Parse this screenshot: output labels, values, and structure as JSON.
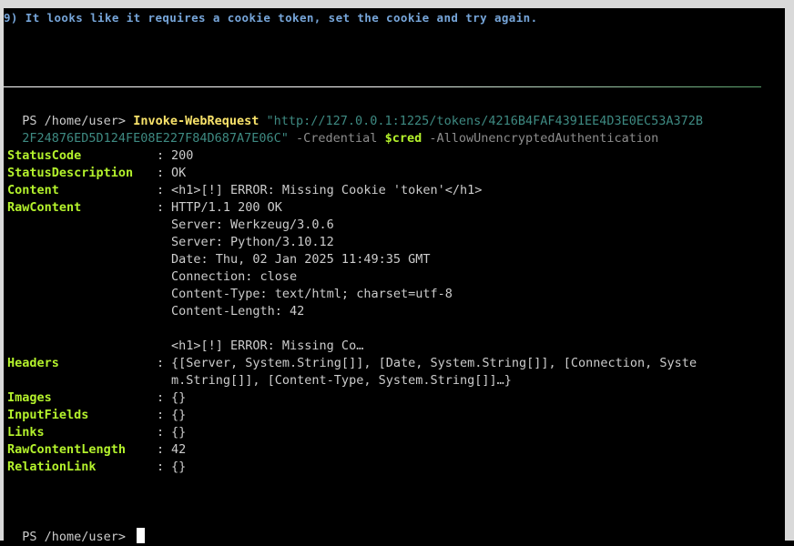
{
  "banner": "9) It looks like it requires a cookie token, set the cookie and try again.",
  "command": {
    "prompt": "PS /home/user> ",
    "cmdlet": "Invoke-WebRequest",
    "url_line1": "\"http://127.0.0.1:1225/tokens/4216B4FAF4391EE4D3E0EC53A372B",
    "url_line2": "2F24876ED5D124FE08E227F84D687A7E06C\"",
    "param1": "-Credential",
    "variable": "$cred",
    "param2": "-AllowUnencryptedAuthentication"
  },
  "output": {
    "separator": ":",
    "status_code": {
      "key": "StatusCode",
      "value": "200"
    },
    "status_description": {
      "key": "StatusDescription",
      "value": "OK"
    },
    "content": {
      "key": "Content",
      "value": "<h1>[!] ERROR: Missing Cookie 'token'</h1>"
    },
    "raw_content": {
      "key": "RawContent",
      "lines": [
        "HTTP/1.1 200 OK",
        "Server: Werkzeug/3.0.6",
        "Server: Python/3.10.12",
        "Date: Thu, 02 Jan 2025 11:49:35 GMT",
        "Connection: close",
        "Content-Type: text/html; charset=utf-8",
        "Content-Length: 42",
        "",
        "<h1>[!] ERROR: Missing Co…"
      ]
    },
    "headers": {
      "key": "Headers",
      "line1": "{[Server, System.String[]], [Date, System.String[]], [Connection, Syste",
      "line2": "m.String[]], [Content-Type, System.String[]]…}"
    },
    "images": {
      "key": "Images",
      "value": "{}"
    },
    "input_fields": {
      "key": "InputFields",
      "value": "{}"
    },
    "links": {
      "key": "Links",
      "value": "{}"
    },
    "raw_content_length": {
      "key": "RawContentLength",
      "value": "42"
    },
    "relation_link": {
      "key": "RelationLink",
      "value": "{}"
    }
  },
  "final_prompt": "PS /home/user> ",
  "colors": {
    "background": "#000000",
    "frame": "#d9d9d9",
    "banner": "#76a5d9",
    "key": "#b4f22c",
    "cmdlet": "#f8e26a",
    "string": "#3e8a82",
    "parameter": "#8d8d8d",
    "text": "#cccccc"
  }
}
